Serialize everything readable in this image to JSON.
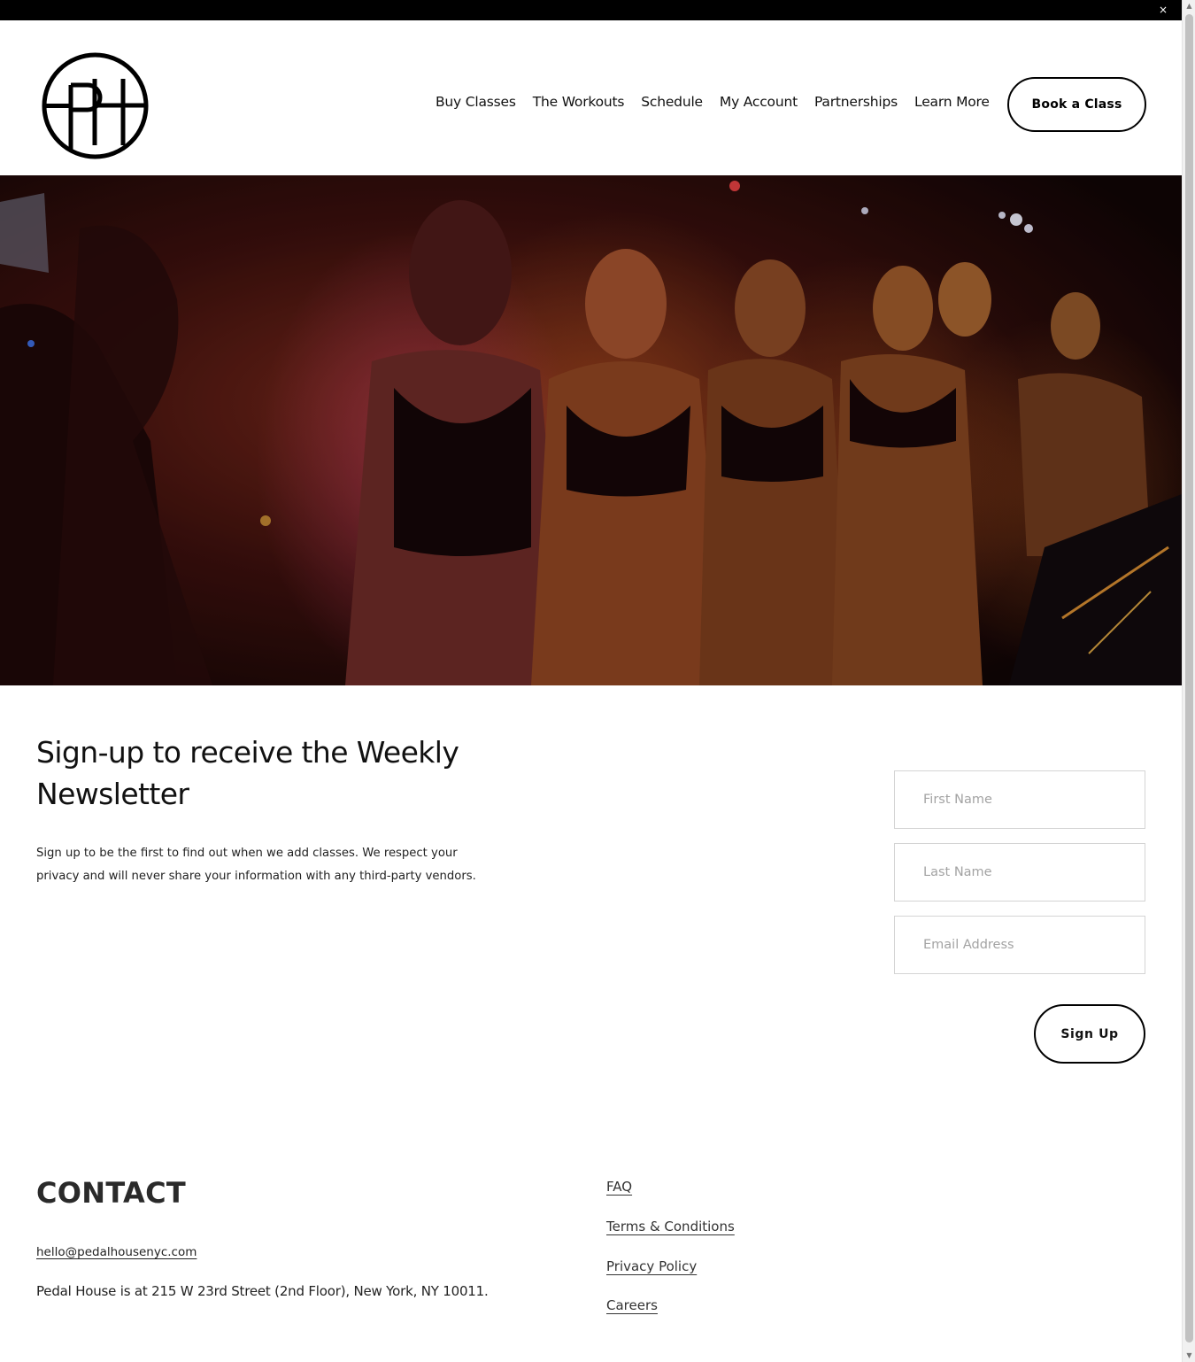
{
  "announcement_bar": {
    "close_glyph": "×",
    "close_icon": "close-icon"
  },
  "header": {
    "logo_text": "PH",
    "nav": [
      {
        "label": "Buy Classes"
      },
      {
        "label": "The Workouts"
      },
      {
        "label": "Schedule"
      },
      {
        "label": "My Account"
      },
      {
        "label": "Partnerships"
      },
      {
        "label": "Learn More"
      }
    ],
    "cta_label": "Book a Class"
  },
  "hero": {
    "image_description": "hero-photo"
  },
  "newsletter": {
    "title": "Sign-up to receive the Weekly Newsletter",
    "description": "Sign up to be the first to find out when we add classes. We respect your privacy and will never share your information with any third-party vendors.",
    "fields": {
      "first_name_placeholder": "First Name",
      "last_name_placeholder": "Last Name",
      "email_placeholder": "Email Address"
    },
    "submit_label": "Sign Up"
  },
  "contact": {
    "heading": "CONTACT",
    "email": "hello@pedalhousenyc.com",
    "address": "Pedal House is at 215 W 23rd Street (2nd Floor), New York, NY 10011."
  },
  "footer_links": [
    {
      "label": "FAQ"
    },
    {
      "label": "Terms & Conditions"
    },
    {
      "label": "Privacy Policy"
    },
    {
      "label": "Careers"
    }
  ],
  "colors": {
    "accent": "#000000",
    "background": "#ffffff",
    "hero_dark": "#170807",
    "hero_warm": "#b3541c"
  }
}
